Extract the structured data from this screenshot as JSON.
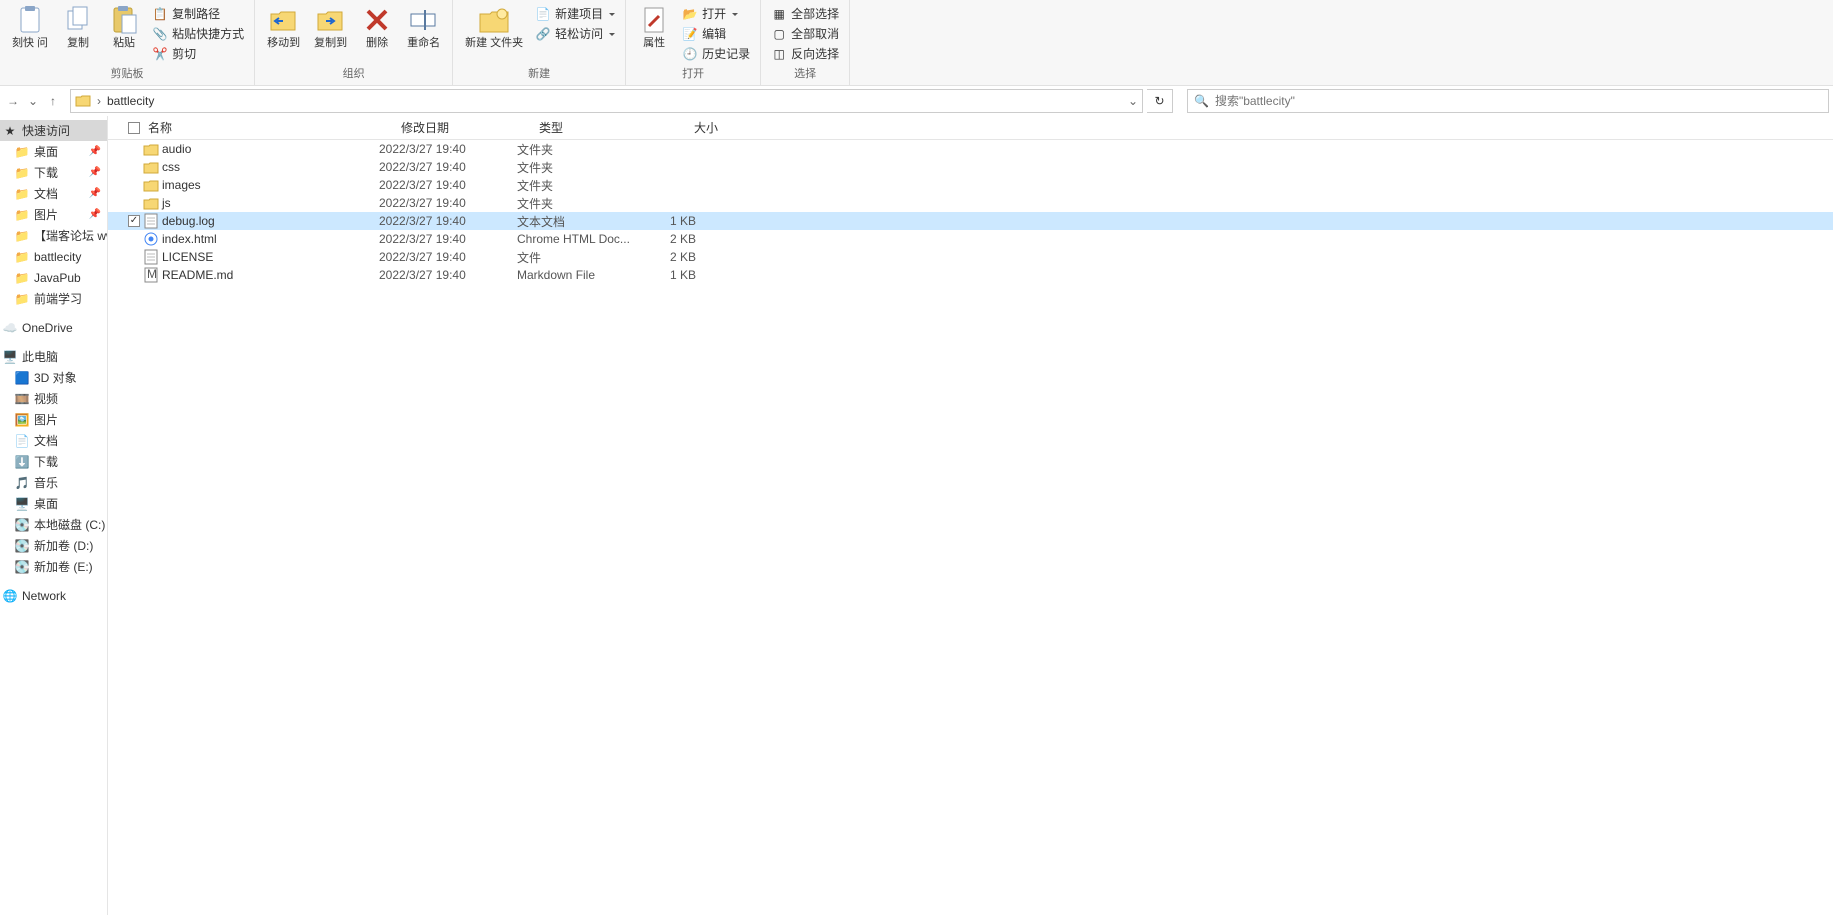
{
  "ribbon": {
    "clipboard": {
      "label": "剪贴板",
      "copy_ask": "刻快\n问",
      "copy": "复制",
      "paste": "粘贴",
      "copy_path": "复制路径",
      "paste_shortcut": "粘贴快捷方式",
      "cut": "剪切"
    },
    "organize": {
      "label": "组织",
      "move_to": "移动到",
      "copy_to": "复制到",
      "delete": "删除",
      "rename": "重命名"
    },
    "new": {
      "label": "新建",
      "new_folder": "新建\n文件夹",
      "new_item": "新建项目",
      "easy_access": "轻松访问"
    },
    "open": {
      "label": "打开",
      "properties": "属性",
      "open": "打开",
      "edit": "编辑",
      "history": "历史记录"
    },
    "select": {
      "label": "选择",
      "select_all": "全部选择",
      "select_none": "全部取消",
      "invert": "反向选择"
    }
  },
  "nav": {
    "crumb": "battlecity",
    "search_placeholder": "搜索\"battlecity\""
  },
  "sidebar": {
    "quick_access": "快速访问",
    "items_pinned": [
      "桌面",
      "下载",
      "文档",
      "图片"
    ],
    "items_recent": [
      "【瑞客论坛 www.ru",
      "battlecity",
      "JavaPub",
      "前端学习"
    ],
    "onedrive": "OneDrive",
    "this_pc": "此电脑",
    "pc_items": [
      "3D 对象",
      "视频",
      "图片",
      "文档",
      "下载",
      "音乐",
      "桌面",
      "本地磁盘 (C:)",
      "新加卷 (D:)",
      "新加卷 (E:)"
    ],
    "network": "Network"
  },
  "columns": {
    "name": "名称",
    "date": "修改日期",
    "type": "类型",
    "size": "大小"
  },
  "rows": [
    {
      "icon": "folder",
      "name": "audio",
      "date": "2022/3/27 19:40",
      "type": "文件夹",
      "size": "",
      "sel": false
    },
    {
      "icon": "folder",
      "name": "css",
      "date": "2022/3/27 19:40",
      "type": "文件夹",
      "size": "",
      "sel": false
    },
    {
      "icon": "folder",
      "name": "images",
      "date": "2022/3/27 19:40",
      "type": "文件夹",
      "size": "",
      "sel": false
    },
    {
      "icon": "folder",
      "name": "js",
      "date": "2022/3/27 19:40",
      "type": "文件夹",
      "size": "",
      "sel": false
    },
    {
      "icon": "text",
      "name": "debug.log",
      "date": "2022/3/27 19:40",
      "type": "文本文档",
      "size": "1 KB",
      "sel": true,
      "checked": true
    },
    {
      "icon": "chrome",
      "name": "index.html",
      "date": "2022/3/27 19:40",
      "type": "Chrome HTML Doc...",
      "size": "2 KB",
      "sel": false
    },
    {
      "icon": "file",
      "name": "LICENSE",
      "date": "2022/3/27 19:40",
      "type": "文件",
      "size": "2 KB",
      "sel": false
    },
    {
      "icon": "md",
      "name": "README.md",
      "date": "2022/3/27 19:40",
      "type": "Markdown File",
      "size": "1 KB",
      "sel": false
    }
  ]
}
